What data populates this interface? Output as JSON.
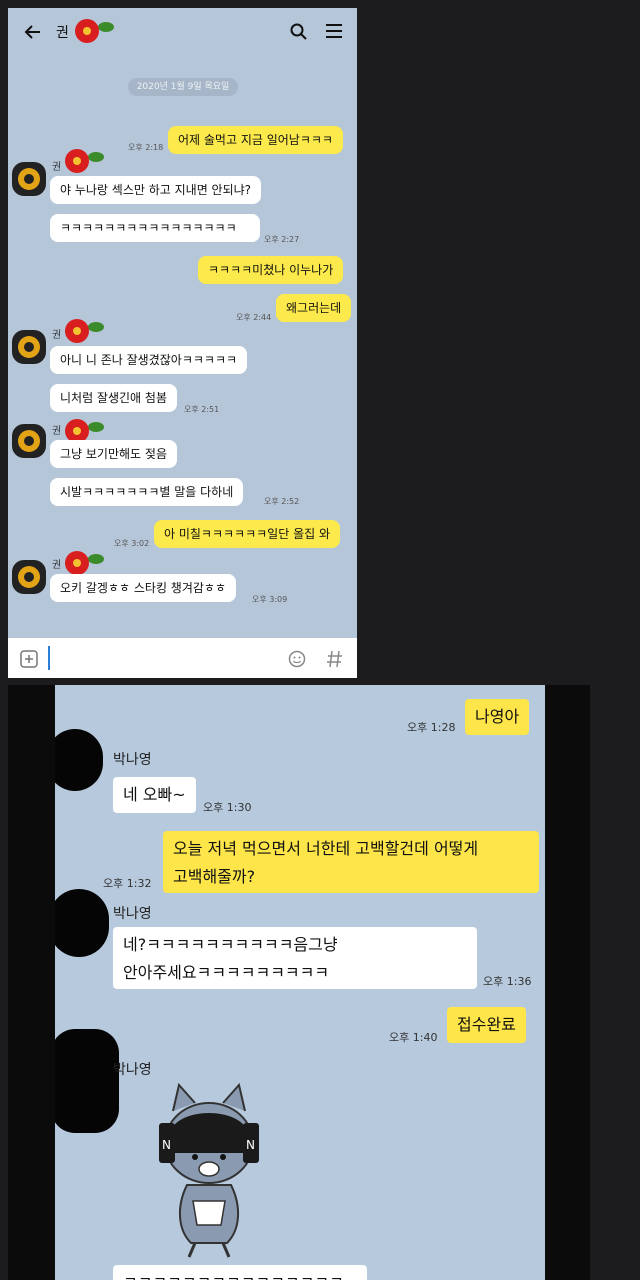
{
  "panel1": {
    "header": {
      "title": "권"
    },
    "date_divider": "2020년 1월 9일 목요일",
    "sender_name": "권",
    "messages": [
      {
        "text": "어제 술먹고 지금 일어남ㅋㅋㅋ",
        "time": "오후 2:18"
      },
      {
        "text": "야 누나랑 섹스만 하고 지내면 안되냐?"
      },
      {
        "text": "ㅋㅋㅋㅋㅋㅋㅋㅋㅋㅋㅋㅋㅋㅋㅋㅋ",
        "time": "오후 2:27"
      },
      {
        "text": "ㅋㅋㅋㅋ미쳤나 이누나가"
      },
      {
        "text": "왜그러는데",
        "time": "오후 2:44"
      },
      {
        "text": "아니 니 존나 잘생겼잖아ㅋㅋㅋㅋㅋ"
      },
      {
        "text": "니처럼 잘생긴애 첨봄",
        "time": "오후 2:51"
      },
      {
        "text": "그냥 보기만해도 젖음"
      },
      {
        "text": "시발ㅋㅋㅋㅋㅋㅋㅋ별 말을 다하네",
        "time": "오후 2:52"
      },
      {
        "text": "아 미칠ㅋㅋㅋㅋㅋㅋ일단 올집 와",
        "time": "오후 3:02"
      },
      {
        "text": "오키 갈겡ㅎㅎ 스타킹 챙겨감ㅎㅎ",
        "time": "오후 3:09"
      }
    ],
    "input": {
      "value": ""
    }
  },
  "panel2": {
    "sender_name": "박나영",
    "messages": [
      {
        "text": "나영아",
        "time": "오후 1:28"
      },
      {
        "text": "네 오빠~",
        "time": "오후 1:30"
      },
      {
        "lines": [
          "오늘 저녁 먹으면서 너한테 고백할건데 어떻게",
          "고백해줄까?"
        ],
        "time": "오후 1:32"
      },
      {
        "lines": [
          "네?ㅋㅋㅋㅋㅋㅋㅋㅋㅋㅋ음그냥",
          "안아주세요ㅋㅋㅋㅋㅋㅋㅋㅋㅋ"
        ],
        "time": "오후 1:36"
      },
      {
        "text": "접수완료",
        "time": "오후 1:40"
      },
      {
        "text": "ㅋㅋㅋㅋㅋㅋㅋㅋㅋㅋㅋㅋㅋㅋㅋ네"
      }
    ]
  },
  "colors": {
    "chat_bg": "#b6c6d9",
    "my_bubble": "#fce94b",
    "their_bubble": "#ffffff",
    "page_bg": "#1c1c1e"
  },
  "icons": [
    "back-arrow-icon",
    "search-icon",
    "menu-icon",
    "flower-icon",
    "plus-icon",
    "emoji-icon",
    "hash-icon",
    "kakao-character-sticker"
  ]
}
